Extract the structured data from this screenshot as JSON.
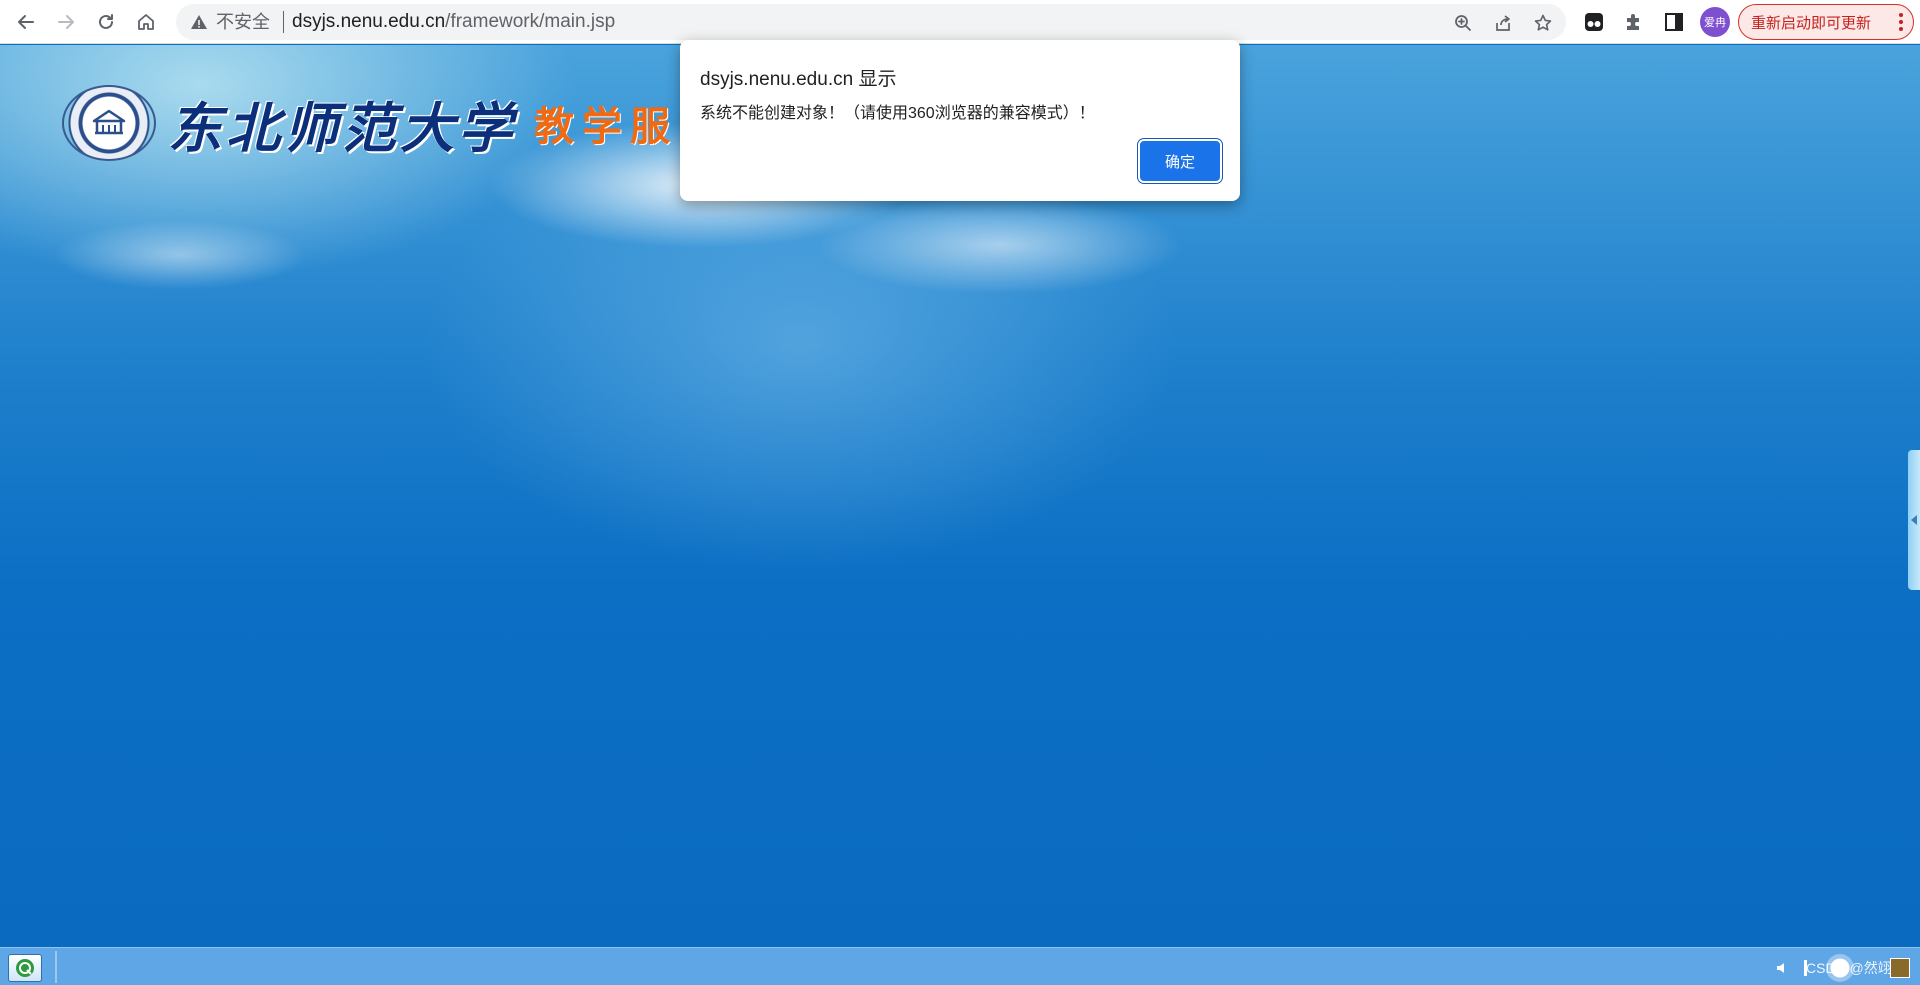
{
  "browser": {
    "security_label": "不安全",
    "url_host": "dsyjs.nenu.edu.cn",
    "url_path": "/framework/main.jsp",
    "profile_avatar": "爱冉",
    "update_button_label": "重新启动即可更新",
    "colors": {
      "omnibox_bg": "#f1f3f4",
      "update_border": "#d93025",
      "avatar_bg": "#7e4fcf"
    }
  },
  "page": {
    "university_name": "东北师范大学",
    "system_name": "教学服务系统"
  },
  "dialog": {
    "title": "dsyjs.nenu.edu.cn 显示",
    "message": "系统不能创建对象！（请使用360浏览器的兼容模式）！",
    "ok_label": "确定",
    "accent_color": "#1a73e8"
  },
  "taskbar": {
    "watermark": "CSDN @然翊川"
  }
}
